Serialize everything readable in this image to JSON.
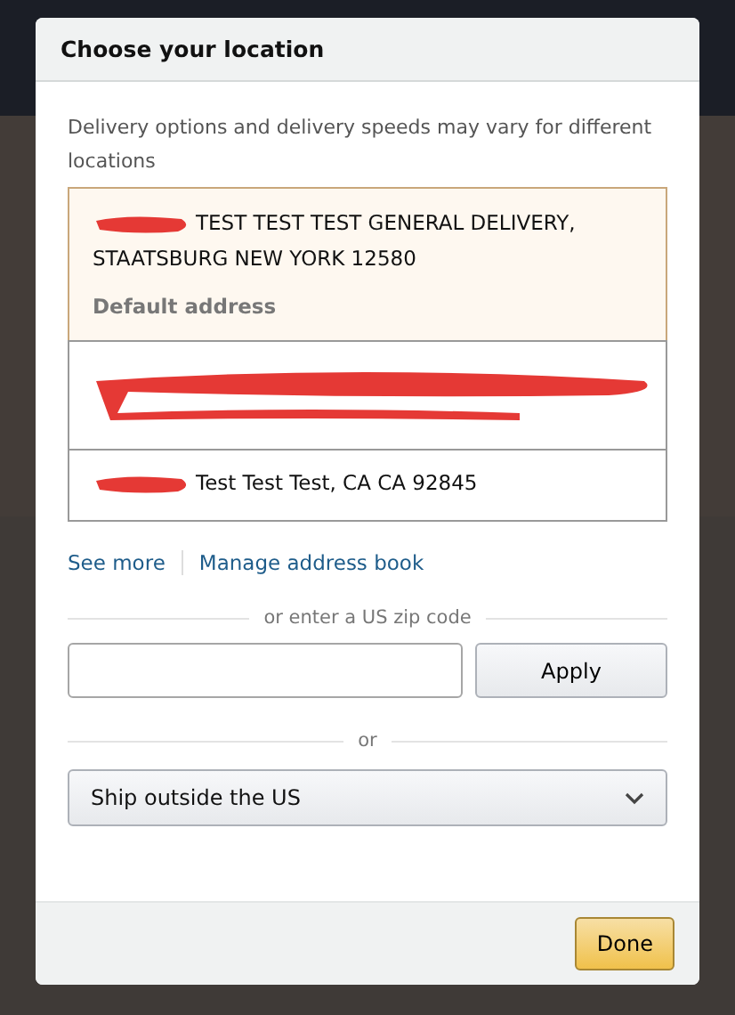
{
  "dialog": {
    "title": "Choose your location",
    "intro": "Delivery options and delivery speeds may vary for different locations"
  },
  "addresses": [
    {
      "kind": "partial",
      "text": "TEST TEST TEST GENERAL DELIVERY, STAATSBURG NEW YORK 12580",
      "tag": "Default address",
      "selected": true
    },
    {
      "kind": "hidden",
      "selected": false
    },
    {
      "kind": "partial",
      "text": "Test Test Test, CA CA 92845",
      "selected": false
    }
  ],
  "links": [
    "See more",
    "Manage address book"
  ],
  "zip": {
    "divider": "or enter a US zip code",
    "button": "Apply"
  },
  "or_divider": "or",
  "country_select": {
    "value": "Ship outside the US"
  },
  "done_button": "Done"
}
